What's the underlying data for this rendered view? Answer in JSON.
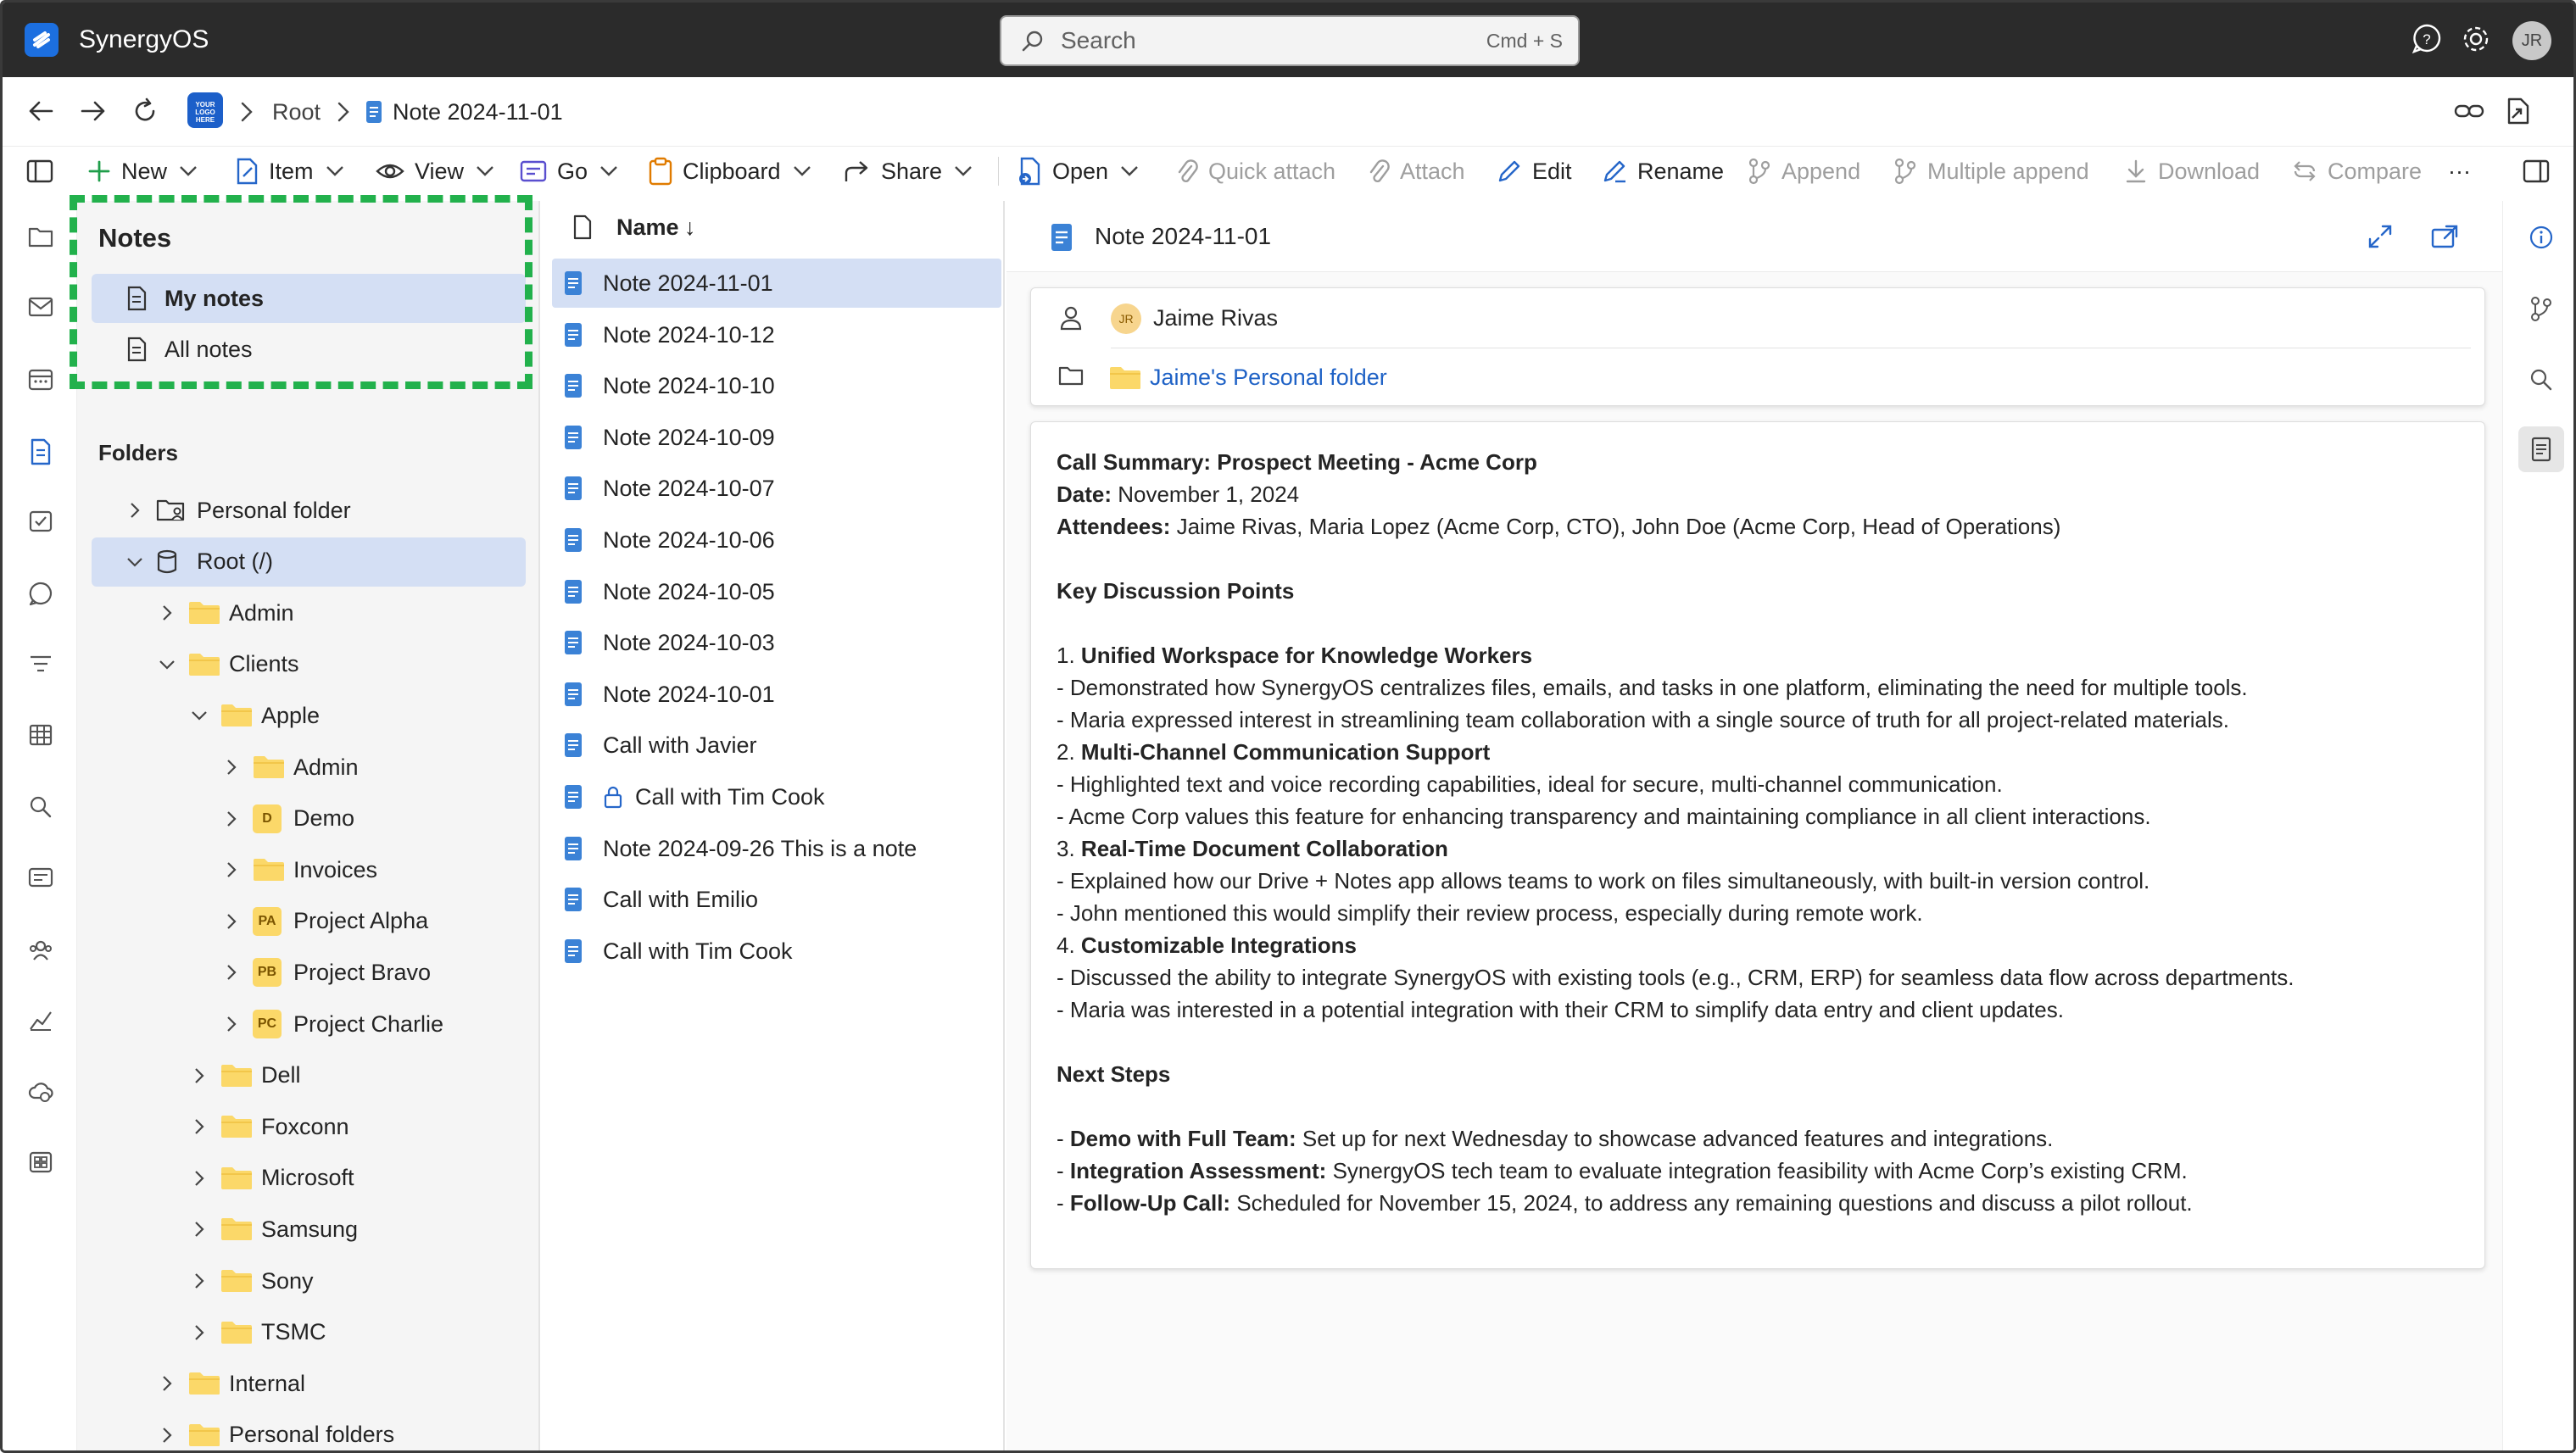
{
  "app": {
    "title": "SynergyOS",
    "user_initials": "JR",
    "search_placeholder": "Search",
    "search_shortcut": "Cmd + S"
  },
  "breadcrumb": {
    "org_logo_text": "YOUR LOGO HERE",
    "items": [
      "Root",
      "Note 2024-11-01"
    ]
  },
  "toolbar": {
    "items": [
      {
        "label": "New",
        "icon": "plus-icon",
        "dropdown": true,
        "enabled": true
      },
      {
        "label": "Item",
        "icon": "item-icon",
        "dropdown": true,
        "enabled": true
      },
      {
        "label": "View",
        "icon": "eye-icon",
        "dropdown": true,
        "enabled": true
      },
      {
        "label": "Go",
        "icon": "go-icon",
        "dropdown": true,
        "enabled": true
      },
      {
        "label": "Clipboard",
        "icon": "clipboard-icon",
        "dropdown": true,
        "enabled": true
      },
      {
        "label": "Share",
        "icon": "share-icon",
        "dropdown": true,
        "enabled": true
      },
      {
        "label": "Open",
        "icon": "open-icon",
        "dropdown": true,
        "enabled": true
      },
      {
        "label": "Quick attach",
        "icon": "paperclip-icon",
        "dropdown": false,
        "enabled": false
      },
      {
        "label": "Attach",
        "icon": "paperclip-icon",
        "dropdown": false,
        "enabled": false
      },
      {
        "label": "Edit",
        "icon": "pencil-icon",
        "dropdown": false,
        "enabled": true
      },
      {
        "label": "Rename",
        "icon": "rename-icon",
        "dropdown": false,
        "enabled": true
      },
      {
        "label": "Append",
        "icon": "append-icon",
        "dropdown": false,
        "enabled": false
      },
      {
        "label": "Multiple append",
        "icon": "multiple-append-icon",
        "dropdown": false,
        "enabled": false
      },
      {
        "label": "Download",
        "icon": "download-icon",
        "dropdown": false,
        "enabled": false
      },
      {
        "label": "Compare",
        "icon": "compare-icon",
        "dropdown": false,
        "enabled": false
      }
    ],
    "more_label": "···"
  },
  "sidebar": {
    "notes_title": "Notes",
    "notes_items": [
      {
        "label": "My notes",
        "selected": true
      },
      {
        "label": "All notes",
        "selected": false
      }
    ],
    "folders_title": "Folders",
    "tree": [
      {
        "label": "Personal folder",
        "depth": 0,
        "expanded": false,
        "kind": "personal"
      },
      {
        "label": "Root (/)",
        "depth": 0,
        "expanded": true,
        "kind": "root",
        "selected": true
      },
      {
        "label": "Admin",
        "depth": 1,
        "expanded": false,
        "kind": "folder"
      },
      {
        "label": "Clients",
        "depth": 1,
        "expanded": true,
        "kind": "folder"
      },
      {
        "label": "Apple",
        "depth": 2,
        "expanded": true,
        "kind": "folder"
      },
      {
        "label": "Admin",
        "depth": 3,
        "expanded": false,
        "kind": "folder"
      },
      {
        "label": "Demo",
        "depth": 3,
        "expanded": false,
        "kind": "badge",
        "badge": "D"
      },
      {
        "label": "Invoices",
        "depth": 3,
        "expanded": false,
        "kind": "folder"
      },
      {
        "label": "Project Alpha",
        "depth": 3,
        "expanded": false,
        "kind": "badge",
        "badge": "PA"
      },
      {
        "label": "Project Bravo",
        "depth": 3,
        "expanded": false,
        "kind": "badge",
        "badge": "PB"
      },
      {
        "label": "Project Charlie",
        "depth": 3,
        "expanded": false,
        "kind": "badge",
        "badge": "PC"
      },
      {
        "label": "Dell",
        "depth": 2,
        "expanded": false,
        "kind": "folder"
      },
      {
        "label": "Foxconn",
        "depth": 2,
        "expanded": false,
        "kind": "folder"
      },
      {
        "label": "Microsoft",
        "depth": 2,
        "expanded": false,
        "kind": "folder"
      },
      {
        "label": "Samsung",
        "depth": 2,
        "expanded": false,
        "kind": "folder"
      },
      {
        "label": "Sony",
        "depth": 2,
        "expanded": false,
        "kind": "folder"
      },
      {
        "label": "TSMC",
        "depth": 2,
        "expanded": false,
        "kind": "folder"
      },
      {
        "label": "Internal",
        "depth": 1,
        "expanded": false,
        "kind": "folder"
      },
      {
        "label": "Personal folders",
        "depth": 1,
        "expanded": false,
        "kind": "folder"
      }
    ]
  },
  "filelist": {
    "header": "Name",
    "sort": "↓",
    "rows": [
      {
        "label": "Note 2024-11-01",
        "selected": true,
        "locked": false
      },
      {
        "label": "Note 2024-10-12",
        "selected": false,
        "locked": false
      },
      {
        "label": "Note 2024-10-10",
        "selected": false,
        "locked": false
      },
      {
        "label": "Note 2024-10-09",
        "selected": false,
        "locked": false
      },
      {
        "label": "Note 2024-10-07",
        "selected": false,
        "locked": false
      },
      {
        "label": "Note 2024-10-06",
        "selected": false,
        "locked": false
      },
      {
        "label": "Note 2024-10-05",
        "selected": false,
        "locked": false
      },
      {
        "label": "Note 2024-10-03",
        "selected": false,
        "locked": false
      },
      {
        "label": "Note 2024-10-01",
        "selected": false,
        "locked": false
      },
      {
        "label": "Call with Javier",
        "selected": false,
        "locked": false
      },
      {
        "label": "Call with Tim Cook",
        "selected": false,
        "locked": true
      },
      {
        "label": "Note 2024-09-26 This is a note",
        "selected": false,
        "locked": false
      },
      {
        "label": "Call with Emilio",
        "selected": false,
        "locked": false
      },
      {
        "label": "Call with Tim Cook",
        "selected": false,
        "locked": false
      }
    ]
  },
  "preview": {
    "title": "Note 2024-11-01",
    "owner_initials": "JR",
    "owner": "Jaime Rivas",
    "location": "Jaime's Personal folder",
    "lines": [
      [
        {
          "b": "Call Summary: Prospect Meeting - Acme Corp"
        }
      ],
      [
        {
          "b": "Date:"
        },
        {
          "t": " November 1, 2024"
        }
      ],
      [
        {
          "b": "Attendees:"
        },
        {
          "t": " Jaime Rivas, Maria Lopez (Acme Corp, CTO), John Doe (Acme Corp, Head of Operations)"
        }
      ],
      [],
      [
        {
          "b": "Key Discussion Points"
        }
      ],
      [],
      [
        {
          "t": "1. "
        },
        {
          "b": "Unified Workspace for Knowledge Workers"
        }
      ],
      [
        {
          "t": "- Demonstrated how SynergyOS centralizes files, emails, and tasks in one platform, eliminating the need for multiple tools."
        }
      ],
      [
        {
          "t": "- Maria expressed interest in streamlining team collaboration with a single source of truth for all project-related materials."
        }
      ],
      [
        {
          "t": "2. "
        },
        {
          "b": "Multi-Channel Communication Support"
        }
      ],
      [
        {
          "t": "- Highlighted text and voice recording capabilities, ideal for secure, multi-channel communication."
        }
      ],
      [
        {
          "t": "- Acme Corp values this feature for enhancing transparency and maintaining compliance in all client interactions."
        }
      ],
      [
        {
          "t": "3. "
        },
        {
          "b": "Real-Time Document Collaboration"
        }
      ],
      [
        {
          "t": "- Explained how our Drive + Notes app allows teams to work on files simultaneously, with built-in version control."
        }
      ],
      [
        {
          "t": "- John mentioned this would simplify their review process, especially during remote work."
        }
      ],
      [
        {
          "t": "4. "
        },
        {
          "b": "Customizable Integrations"
        }
      ],
      [
        {
          "t": "- Discussed the ability to integrate SynergyOS with existing tools (e.g., CRM, ERP) for seamless data flow across departments."
        }
      ],
      [
        {
          "t": "- Maria was interested in a potential integration with their CRM to simplify data entry and client updates."
        }
      ],
      [],
      [
        {
          "b": "Next Steps"
        }
      ],
      [],
      [
        {
          "t": "- "
        },
        {
          "b": "Demo with Full Team:"
        },
        {
          "t": " Set up for next Wednesday to showcase advanced features and integrations."
        }
      ],
      [
        {
          "t": "- "
        },
        {
          "b": "Integration Assessment:"
        },
        {
          "t": " SynergyOS tech team to evaluate integration feasibility with Acme Corp’s existing CRM."
        }
      ],
      [
        {
          "t": "- "
        },
        {
          "b": "Follow-Up Call:"
        },
        {
          "t": " Scheduled for November 15, 2024, to address any remaining questions and discuss a pilot rollout."
        }
      ]
    ]
  },
  "colors": {
    "titlebar": "#2b2b2b",
    "selection": "#d4dff4",
    "accent": "#1f62c6",
    "folder": "#fbd869",
    "highlight": "#22b14c"
  }
}
